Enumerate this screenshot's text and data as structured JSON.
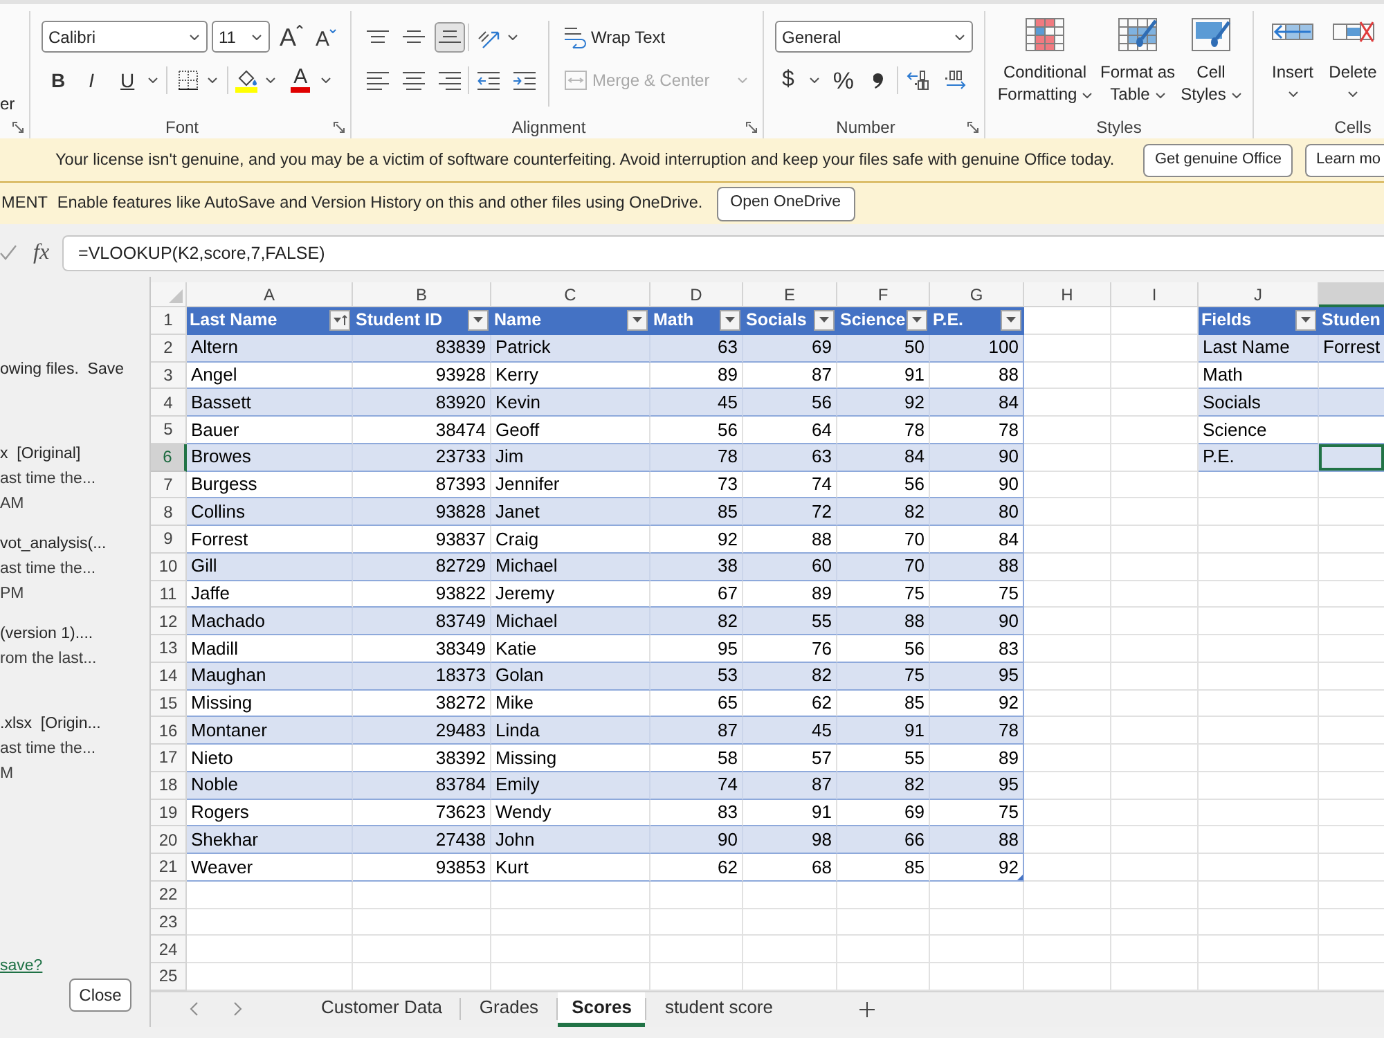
{
  "ribbon": {
    "clipboard": {
      "fragment": "er"
    },
    "font": {
      "label": "Font",
      "font_name": "Calibri",
      "font_size": "11",
      "size_buttons": [
        {
          "kind": "grow",
          "label": "A"
        },
        {
          "kind": "shrink",
          "label": "A"
        }
      ],
      "style_buttons": [
        {
          "kind": "bold",
          "label": "B"
        },
        {
          "kind": "italic",
          "label": "I"
        },
        {
          "kind": "underline",
          "label": "U"
        }
      ],
      "font_color_label": "A"
    },
    "alignment": {
      "label": "Alignment",
      "vertical": [
        {
          "kind": "top",
          "selected": false
        },
        {
          "kind": "middle",
          "selected": false
        },
        {
          "kind": "bottom",
          "selected": true
        }
      ],
      "horizontal": [
        {
          "kind": "left",
          "selected": false
        },
        {
          "kind": "center",
          "selected": false
        },
        {
          "kind": "right",
          "selected": false
        }
      ],
      "wrap_text": "Wrap Text",
      "merge": {
        "label": "Merge & Center",
        "disabled": true
      }
    },
    "number": {
      "label": "Number",
      "format": "General",
      "currency": "$",
      "percent": "%"
    },
    "styles": {
      "label": "Styles",
      "buttons": [
        {
          "kind": "conditional",
          "label": "Conditional Formatting"
        },
        {
          "kind": "table",
          "label": "Format as Table"
        },
        {
          "kind": "cell",
          "label": "Cell Styles"
        }
      ]
    },
    "cells": {
      "label": "Cells",
      "buttons": [
        {
          "kind": "insert",
          "label": "Insert"
        },
        {
          "kind": "delete",
          "label": "Delete"
        }
      ]
    }
  },
  "license_banner": {
    "message": "Your license isn't genuine, and you may be a victim of software counterfeiting. Avoid interruption and keep your files safe with genuine Office today.",
    "buttons": [
      "Get genuine Office",
      "Learn mo"
    ]
  },
  "onedrive_banner": {
    "tag": "MENT",
    "message": "Enable features like AutoSave and Version History on this and other files using OneDrive.",
    "button": "Open OneDrive"
  },
  "formula_bar": {
    "function_label": "fx",
    "formula": "=VLOOKUP(K2,score,7,FALSE)"
  },
  "recovery_pane": {
    "intro": "owing files.  Save",
    "files": [
      {
        "name": "x  [Original]",
        "detail": "ast time the...",
        "time": "AM"
      },
      {
        "name": "vot_analysis(...",
        "detail": "ast time the...",
        "time": "PM"
      },
      {
        "name": "(version 1)....",
        "detail": "rom the last..."
      },
      {
        "name": ".xlsx  [Origin...",
        "detail": "ast time the...",
        "time": "M"
      }
    ],
    "link": "save?",
    "button": "Close"
  },
  "sheet": {
    "columns": [
      {
        "label": "A",
        "selected": false
      },
      {
        "label": "B",
        "selected": false
      },
      {
        "label": "C",
        "selected": false
      },
      {
        "label": "D",
        "selected": false
      },
      {
        "label": "E",
        "selected": false
      },
      {
        "label": "F",
        "selected": false
      },
      {
        "label": "G",
        "selected": false
      },
      {
        "label": "H",
        "selected": false
      },
      {
        "label": "I",
        "selected": false
      },
      {
        "label": "J",
        "selected": false
      },
      {
        "selected": true
      }
    ],
    "row_headers": [
      {
        "label": "1",
        "selected": false
      },
      {
        "label": "2",
        "selected": false
      },
      {
        "label": "3",
        "selected": false
      },
      {
        "label": "4",
        "selected": false
      },
      {
        "label": "5",
        "selected": false
      },
      {
        "label": "6",
        "selected": true
      },
      {
        "label": "7",
        "selected": false
      },
      {
        "label": "8",
        "selected": false
      },
      {
        "label": "9",
        "selected": false
      },
      {
        "label": "10",
        "selected": false
      },
      {
        "label": "11",
        "selected": false
      },
      {
        "label": "12",
        "selected": false
      },
      {
        "label": "13",
        "selected": false
      },
      {
        "label": "14",
        "selected": false
      },
      {
        "label": "15",
        "selected": false
      },
      {
        "label": "16",
        "selected": false
      },
      {
        "label": "17",
        "selected": false
      },
      {
        "label": "18",
        "selected": false
      },
      {
        "label": "19",
        "selected": false
      },
      {
        "label": "20",
        "selected": false
      },
      {
        "label": "21",
        "selected": false
      },
      {
        "label": "22",
        "selected": false
      },
      {
        "label": "23",
        "selected": false
      },
      {
        "label": "24",
        "selected": false
      },
      {
        "label": "25",
        "selected": false
      }
    ]
  },
  "score_table": {
    "columns": [
      {
        "label": "Last Name",
        "kind": "text",
        "filter": true,
        "sorted": true
      },
      {
        "label": "Student ID",
        "kind": "number",
        "filter": true,
        "sorted": false
      },
      {
        "label": "Name",
        "kind": "text",
        "filter": true,
        "sorted": false
      },
      {
        "label": "Math",
        "kind": "number",
        "filter": true,
        "sorted": false
      },
      {
        "label": "Socials",
        "kind": "number",
        "filter": true,
        "sorted": false
      },
      {
        "label": "Science",
        "kind": "number",
        "filter": true,
        "sorted": false
      },
      {
        "label": "P.E.",
        "kind": "number",
        "filter": true,
        "sorted": false
      }
    ],
    "rows": [
      [
        "Altern",
        "83839",
        "Patrick",
        "63",
        "69",
        "50",
        "100"
      ],
      [
        "Angel",
        "93928",
        "Kerry",
        "89",
        "87",
        "91",
        "88"
      ],
      [
        "Bassett",
        "83920",
        "Kevin",
        "45",
        "56",
        "92",
        "84"
      ],
      [
        "Bauer",
        "38474",
        "Geoff",
        "56",
        "64",
        "78",
        "78"
      ],
      [
        "Browes",
        "23733",
        "Jim",
        "78",
        "63",
        "84",
        "90"
      ],
      [
        "Burgess",
        "87393",
        "Jennifer",
        "73",
        "74",
        "56",
        "90"
      ],
      [
        "Collins",
        "93828",
        "Janet",
        "85",
        "72",
        "82",
        "80"
      ],
      [
        "Forrest",
        "93837",
        "Craig",
        "92",
        "88",
        "70",
        "84"
      ],
      [
        "Gill",
        "82729",
        "Michael",
        "38",
        "60",
        "70",
        "88"
      ],
      [
        "Jaffe",
        "93822",
        "Jeremy",
        "67",
        "89",
        "75",
        "75"
      ],
      [
        "Machado",
        "83749",
        "Michael",
        "82",
        "55",
        "88",
        "90"
      ],
      [
        "Madill",
        "38349",
        "Katie",
        "95",
        "76",
        "56",
        "83"
      ],
      [
        "Maughan",
        "18373",
        "Golan",
        "53",
        "82",
        "75",
        "95"
      ],
      [
        "Missing",
        "38272",
        "Mike",
        "65",
        "62",
        "85",
        "92"
      ],
      [
        "Montaner",
        "29483",
        "Linda",
        "87",
        "45",
        "91",
        "78"
      ],
      [
        "Nieto",
        "38392",
        "Missing",
        "58",
        "57",
        "55",
        "89"
      ],
      [
        "Noble",
        "83784",
        "Emily",
        "74",
        "87",
        "82",
        "95"
      ],
      [
        "Rogers",
        "73623",
        "Wendy",
        "83",
        "91",
        "69",
        "75"
      ],
      [
        "Shekhar",
        "27438",
        "John",
        "90",
        "98",
        "66",
        "88"
      ],
      [
        "Weaver",
        "93853",
        "Kurt",
        "62",
        "68",
        "85",
        "92"
      ]
    ]
  },
  "lookup_table": {
    "columns": [
      {
        "label": "Fields",
        "filter": true,
        "sorted": false
      },
      {
        "label": "Studen",
        "filter": false
      }
    ],
    "rows": [
      {
        "cells": [
          "Last Name",
          "Forrest"
        ],
        "selected": false
      },
      {
        "cells": [
          "Math"
        ],
        "selected": false
      },
      {
        "cells": [
          "Socials"
        ],
        "selected": false
      },
      {
        "cells": [
          "Science"
        ],
        "selected": false
      },
      {
        "cells": [
          "P.E."
        ],
        "selected": true
      }
    ]
  },
  "sheet_tabs": [
    {
      "label": "Customer Data",
      "selected": false
    },
    {
      "label": "Grades",
      "selected": false
    },
    {
      "label": "Scores",
      "selected": true
    },
    {
      "label": "student score",
      "selected": false
    }
  ]
}
